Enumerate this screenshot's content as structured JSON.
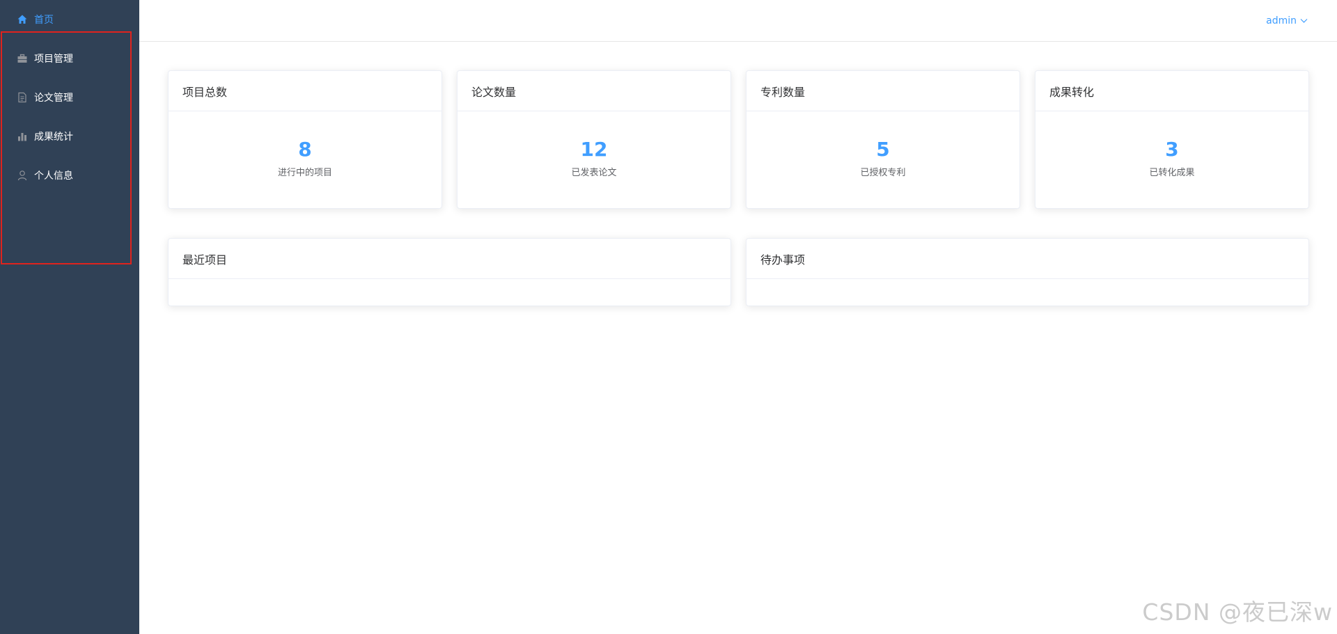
{
  "sidebar": {
    "items": [
      {
        "label": "首页",
        "icon": "home-icon"
      },
      {
        "label": "项目管理",
        "icon": "briefcase-icon"
      },
      {
        "label": "论文管理",
        "icon": "document-icon"
      },
      {
        "label": "成果统计",
        "icon": "bar-chart-icon"
      },
      {
        "label": "个人信息",
        "icon": "user-icon"
      }
    ]
  },
  "header": {
    "user": "admin"
  },
  "stats": [
    {
      "title": "项目总数",
      "value": "8",
      "desc": "进行中的项目"
    },
    {
      "title": "论文数量",
      "value": "12",
      "desc": "已发表论文"
    },
    {
      "title": "专利数量",
      "value": "5",
      "desc": "已授权专利"
    },
    {
      "title": "成果转化",
      "value": "3",
      "desc": "已转化成果"
    }
  ],
  "panels": {
    "recent_projects": "最近项目",
    "todo": "待办事项"
  },
  "watermark": "CSDN @夜已深w",
  "colors": {
    "sidebar_bg": "#304156",
    "accent": "#409eff",
    "annotation_border": "#e0231d"
  }
}
